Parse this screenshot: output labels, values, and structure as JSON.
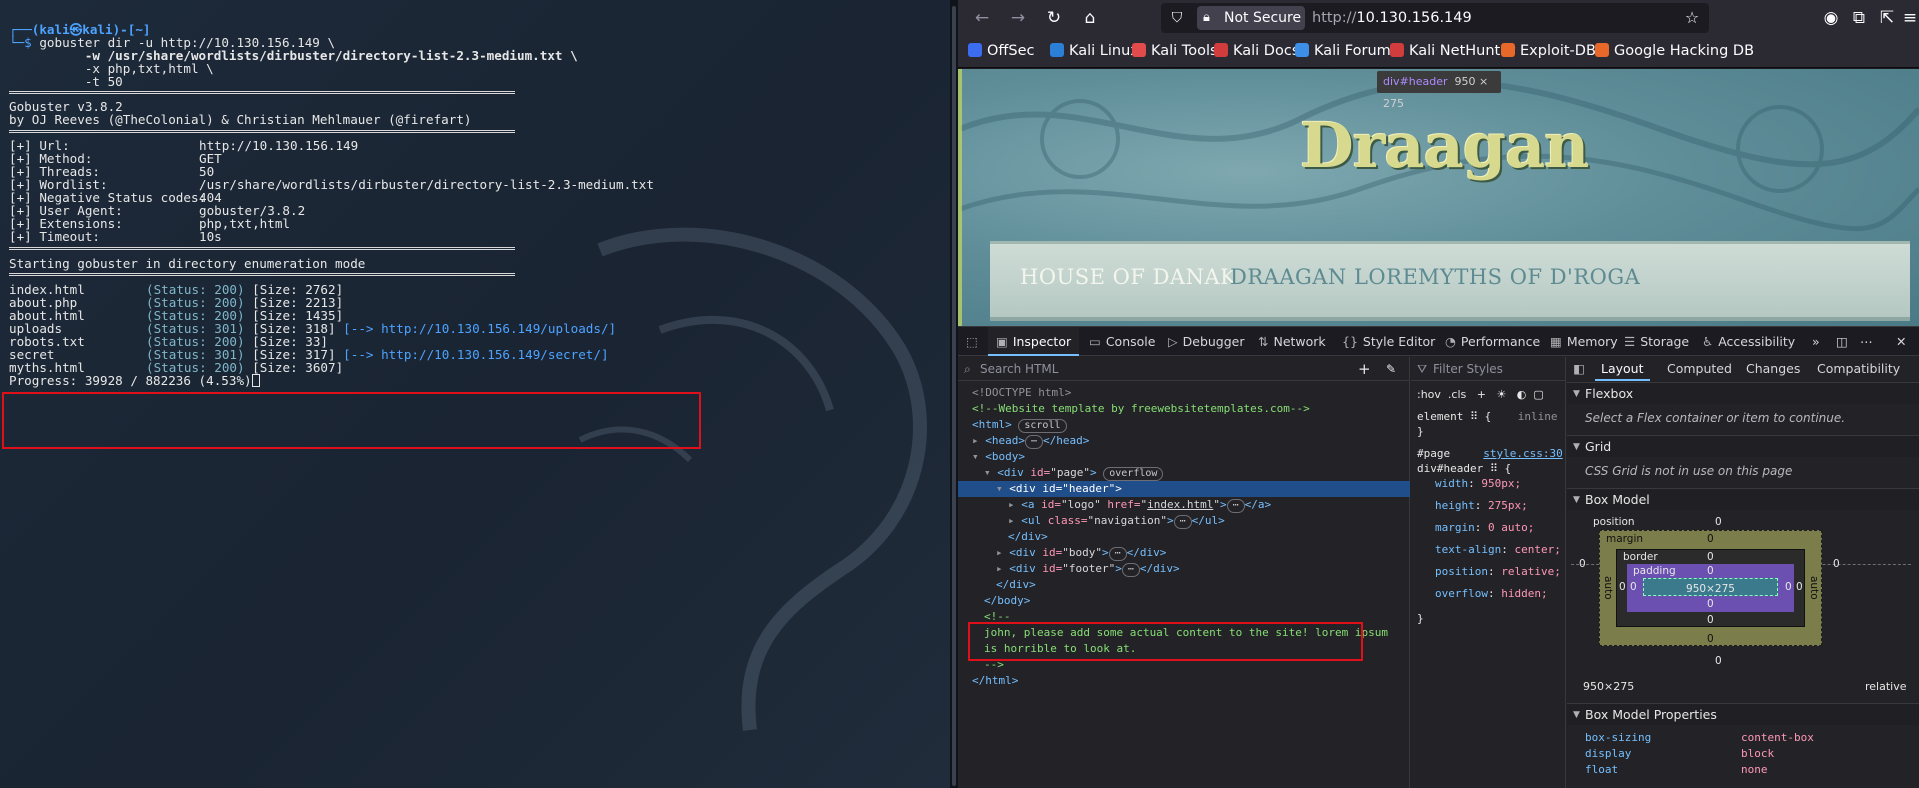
{
  "terminal": {
    "prompt_user": "(kali㉿kali)-[~]",
    "command_lines": [
      "gobuster dir -u http://10.130.156.149 \\",
      "          -w /usr/share/wordlists/dirbuster/directory-list-2.3-medium.txt \\",
      "          -x php,txt,html \\",
      "          -t 50"
    ],
    "banner": [
      "Gobuster v3.8.2",
      "by OJ Reeves (@TheColonial) & Christian Mehlmauer (@firefart)"
    ],
    "config": [
      {
        "k": "[+] Url:",
        "v": "http://10.130.156.149"
      },
      {
        "k": "[+] Method:",
        "v": "GET"
      },
      {
        "k": "[+] Threads:",
        "v": "50"
      },
      {
        "k": "[+] Wordlist:",
        "v": "/usr/share/wordlists/dirbuster/directory-list-2.3-medium.txt"
      },
      {
        "k": "[+] Negative Status codes:",
        "v": "404"
      },
      {
        "k": "[+] User Agent:",
        "v": "gobuster/3.8.2"
      },
      {
        "k": "[+] Extensions:",
        "v": "php,txt,html"
      },
      {
        "k": "[+] Timeout:",
        "v": "10s"
      }
    ],
    "start_msg": "Starting gobuster in directory enumeration mode",
    "results": [
      {
        "path": "index.html",
        "status": "(Status: 200)",
        "size": "[Size: 2762]",
        "redirect": ""
      },
      {
        "path": "about.php",
        "status": "(Status: 200)",
        "size": "[Size: 2213]",
        "redirect": ""
      },
      {
        "path": "about.html",
        "status": "(Status: 200)",
        "size": "[Size: 1435]",
        "redirect": ""
      },
      {
        "path": "uploads",
        "status": "(Status: 301)",
        "size": "[Size: 318]",
        "redirect": "[--> http://10.130.156.149/uploads/]"
      },
      {
        "path": "robots.txt",
        "status": "(Status: 200)",
        "size": "[Size: 33]",
        "redirect": ""
      },
      {
        "path": "secret",
        "status": "(Status: 301)",
        "size": "[Size: 317]",
        "redirect": "[--> http://10.130.156.149/secret/]"
      },
      {
        "path": "myths.html",
        "status": "(Status: 200)",
        "size": "[Size: 3607]",
        "redirect": ""
      }
    ],
    "progress": "Progress: 39928 / 882236 (4.53%)"
  },
  "browser": {
    "not_secure": "Not Secure",
    "url_scheme": "http://",
    "url_host": "10.130.156.149",
    "bookmarks": [
      "OffSec",
      "Kali Linux",
      "Kali Tools",
      "Kali Docs",
      "Kali Forums",
      "Kali NetHunter",
      "Exploit-DB",
      "Google Hacking DB"
    ],
    "site": {
      "title": "Draagan",
      "nav": [
        "HOUSE OF DANAK",
        "DRAAGAN LORE",
        "MYTHS OF D'ROGA"
      ],
      "tooltip_tag": "div#header",
      "tooltip_size": "950 × 275"
    }
  },
  "devtools": {
    "tabs": [
      "Inspector",
      "Console",
      "Debugger",
      "Network",
      "Style Editor",
      "Performance",
      "Memory",
      "Storage",
      "Accessibility"
    ],
    "search_placeholder": "Search HTML",
    "filter_placeholder": "Filter Styles",
    "markup": {
      "doctype": "<!DOCTYPE html>",
      "template_comment": "<!--Website template by freewebsitetemplates.com-->",
      "html_badge": "scroll",
      "page_badge": "overflow",
      "logo_href": "index.html",
      "comment_open": "<!--",
      "comment_line1": "john, please add some actual content to the site! lorem ipsum",
      "comment_line2": "is horrible to look at.",
      "comment_close": "-->"
    },
    "rules": {
      "element_label": "element",
      "inline_label": "inline",
      "page_selector": "#page",
      "source_link": "style.css:30",
      "header_selector": "div#header",
      "props": [
        {
          "k": "width",
          "v": "950px;"
        },
        {
          "k": "height",
          "v": "275px;"
        },
        {
          "k": "margin",
          "v": "0 auto;"
        },
        {
          "k": "text-align",
          "v": "center;"
        },
        {
          "k": "position",
          "v": "relative;"
        },
        {
          "k": "overflow",
          "v": "hidden;"
        }
      ]
    },
    "layout": {
      "tabs": [
        "Layout",
        "Computed",
        "Changes",
        "Compatibility"
      ],
      "flexbox_title": "Flexbox",
      "flexbox_note": "Select a Flex container or item to continue.",
      "grid_title": "Grid",
      "grid_note": "CSS Grid is not in use on this page",
      "box_model_title": "Box Model",
      "box_labels": {
        "position": "position",
        "margin": "margin",
        "border": "border",
        "padding": "padding",
        "content": "950×275",
        "auto": "auto",
        "zero": "0"
      },
      "dims": "950×275",
      "pos_value": "relative",
      "props_title": "Box Model Properties",
      "props": [
        {
          "k": "box-sizing",
          "v": "content-box"
        },
        {
          "k": "display",
          "v": "block"
        },
        {
          "k": "float",
          "v": "none"
        }
      ]
    }
  },
  "colors": {
    "accent": "#75bfff",
    "highlight_red": "#e0101a",
    "terminal_blue": "#4da3ff"
  }
}
